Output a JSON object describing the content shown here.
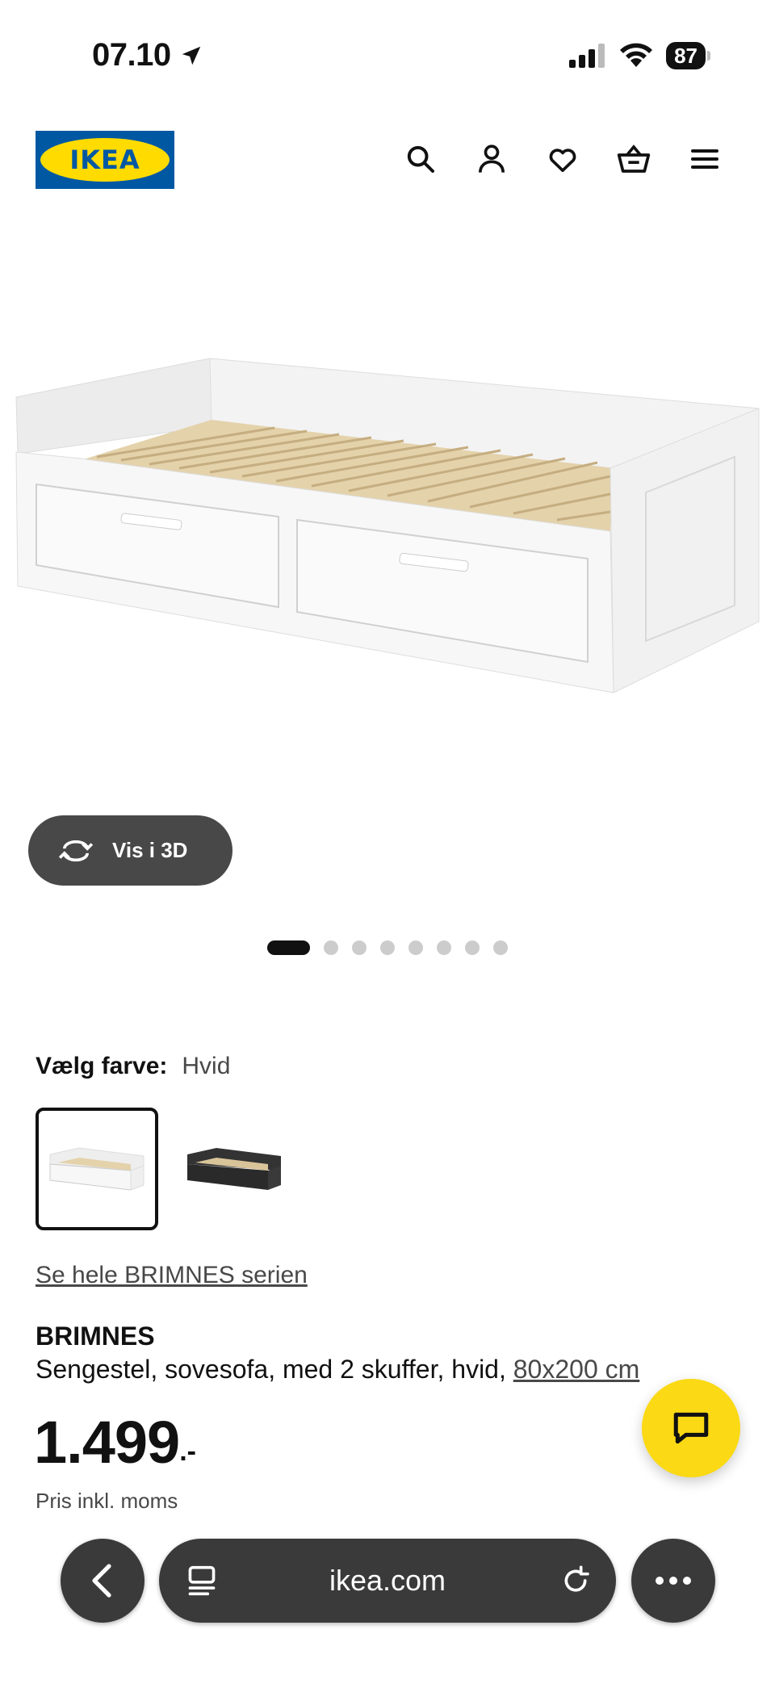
{
  "status_bar": {
    "time": "07.10",
    "battery": "87"
  },
  "header": {
    "logo_text": "IKEA",
    "icons": [
      "search-icon",
      "account-icon",
      "heart-icon",
      "basket-icon",
      "menu-icon"
    ]
  },
  "gallery": {
    "view_3d_label": "Vis i 3D",
    "dot_count": 8,
    "active_dot": 1
  },
  "color_picker": {
    "label": "Vælg farve:",
    "selected_value": "Hvid",
    "swatches": [
      "Hvid",
      "Sort"
    ]
  },
  "series_link": "Se hele BRIMNES serien",
  "product": {
    "name": "BRIMNES",
    "description": "Sengestel, sovesofa, med 2 skuffer, hvid, ",
    "size_link": "80x200 cm",
    "price": "1.499",
    "price_suffix": ".-",
    "price_note": "Pris inkl. moms"
  },
  "browser": {
    "url": "ikea.com"
  },
  "colors": {
    "ikea_blue": "#0058a3",
    "ikea_yellow": "#ffdb00",
    "chat_yellow": "#fbd914",
    "dark_button": "#484848"
  }
}
